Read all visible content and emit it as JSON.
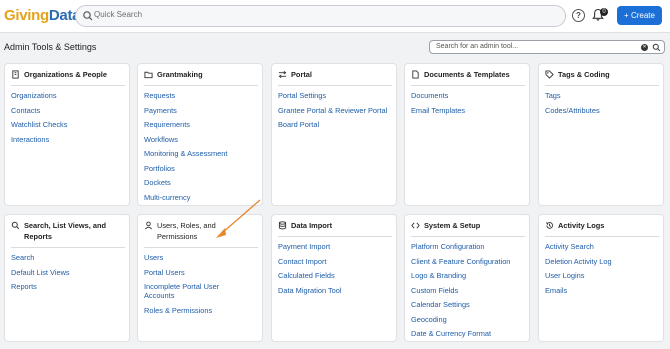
{
  "topbar": {
    "logo_part1": "Giving",
    "logo_part2": "Data",
    "search_placeholder": "Quick Search",
    "help_label": "?",
    "notification_count": "0",
    "create_label": "+ Create"
  },
  "header": {
    "title": "Admin Tools & Settings",
    "search_placeholder": "Search for an admin tool..."
  },
  "cards": [
    {
      "title": "Organizations & People",
      "icon": "building-icon",
      "links": [
        "Organizations",
        "Contacts",
        "Watchlist Checks",
        "Interactions"
      ]
    },
    {
      "title": "Grantmaking",
      "icon": "folder-icon",
      "links": [
        "Requests",
        "Payments",
        "Requirements",
        "Workflows",
        "Monitoring & Assessment",
        "Portfolios",
        "Dockets",
        "Multi-currency"
      ]
    },
    {
      "title": "Portal",
      "icon": "swap-arrows-icon",
      "links": [
        "Portal Settings",
        "Grantee Portal & Reviewer Portal",
        "Board Portal"
      ]
    },
    {
      "title": "Documents & Templates",
      "icon": "document-icon",
      "links": [
        "Documents",
        "Email Templates"
      ]
    },
    {
      "title": "Tags & Coding",
      "icon": "tag-icon",
      "links": [
        "Tags",
        "Codes/Attributes"
      ]
    },
    {
      "title_line1": "Search, List Views, and",
      "title_line2": "Reports",
      "icon": "search-icon",
      "links": [
        "Search",
        "Default List Views",
        "Reports"
      ]
    },
    {
      "title_line1": "Users, Roles, and",
      "title_line2": "Permissions",
      "icon": "user-icon",
      "links": [
        "Users",
        "Portal Users",
        "Incomplete Portal User",
        "Accounts",
        "Roles & Permissions"
      ]
    },
    {
      "title": "Data Import",
      "icon": "database-icon",
      "links": [
        "Payment Import",
        "Contact Import",
        "Calculated Fields",
        "Data Migration Tool"
      ]
    },
    {
      "title": "System & Setup",
      "icon": "code-icon",
      "links": [
        "Platform Configuration",
        "Client & Feature Configuration",
        "Logo & Branding",
        "Custom Fields",
        "Calendar Settings",
        "Geocoding",
        "Date & Currency Format"
      ]
    },
    {
      "title": "Activity Logs",
      "icon": "history-icon",
      "links": [
        "Activity Search",
        "Deletion Activity Log",
        "User Logins",
        "Emails"
      ]
    }
  ],
  "colors": {
    "accent": "#1b6fd6",
    "link": "#1f5da8",
    "annotation_arrow": "#e8872a"
  }
}
